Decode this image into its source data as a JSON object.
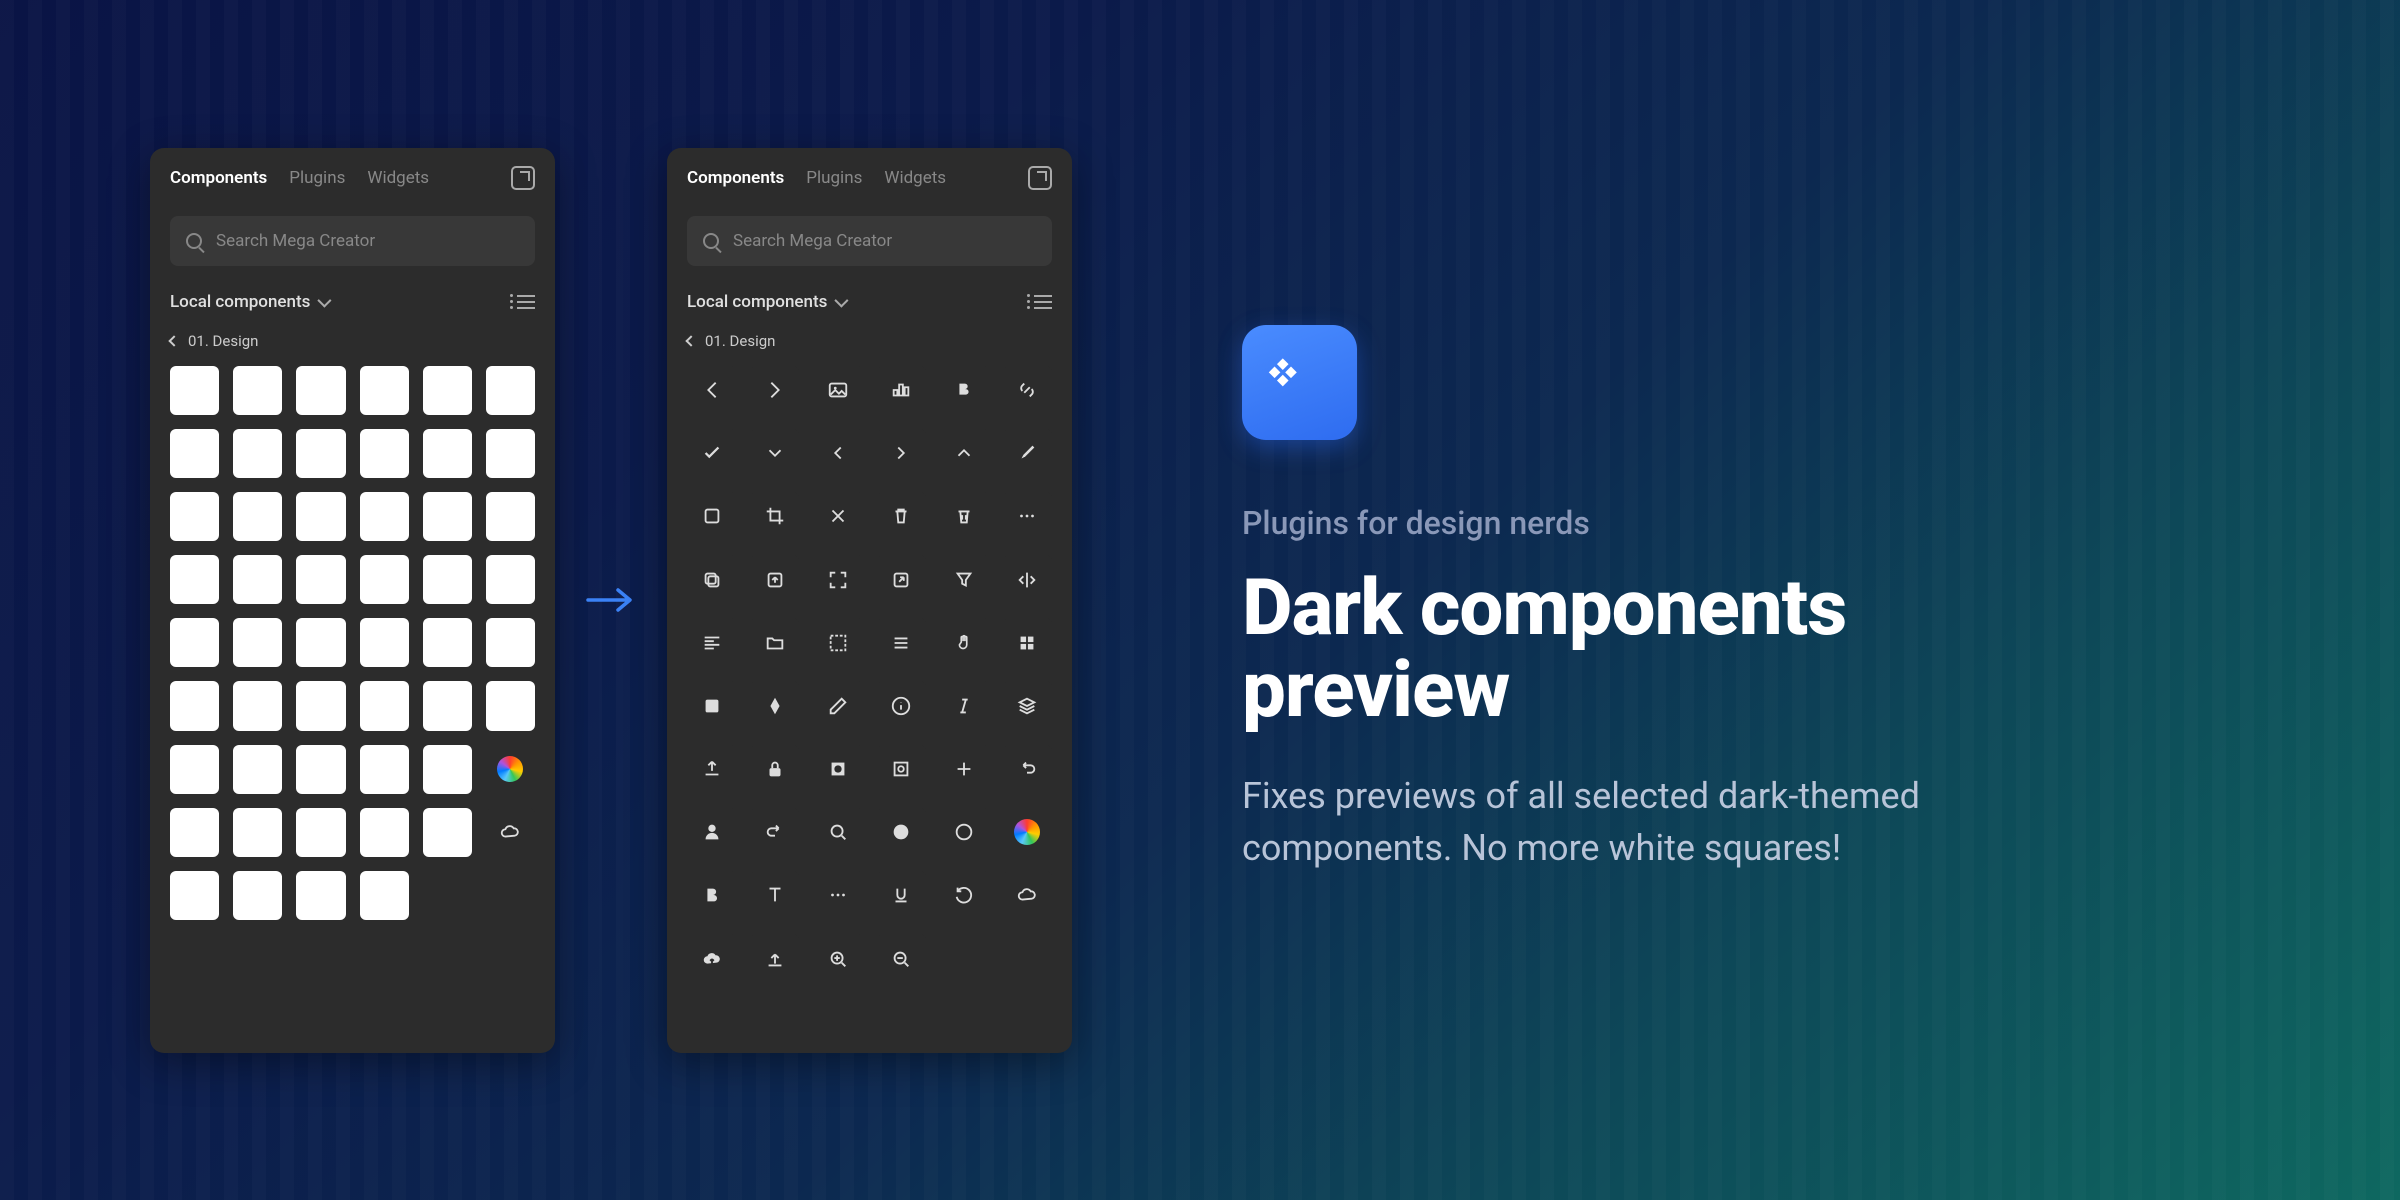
{
  "panel": {
    "tabs": [
      "Components",
      "Plugins",
      "Widgets"
    ],
    "active_tab": 0,
    "search_placeholder": "Search Mega Creator",
    "section_title": "Local components",
    "breadcrumb": "01. Design"
  },
  "left_panel": {
    "thumbnails": {
      "count": 52,
      "special": {
        "color_wheel_index": 41,
        "cloud_index": 47
      }
    }
  },
  "right_panel": {
    "icons": [
      "arrow-left",
      "arrow-right",
      "image",
      "chart",
      "bold",
      "link",
      "check",
      "chevron-down",
      "chevron-left",
      "chevron-right",
      "chevron-up",
      "paint",
      "square",
      "crop",
      "close",
      "trash",
      "trash-2",
      "more",
      "copy",
      "export",
      "fullscreen",
      "external",
      "filter",
      "flip",
      "align-left",
      "folder",
      "group",
      "menu",
      "hand",
      "grid",
      "shape",
      "pen",
      "pencil",
      "info",
      "italic",
      "layers",
      "upload",
      "lock",
      "mask",
      "target",
      "plus",
      "redo",
      "user",
      "undo",
      "search",
      "blob",
      "circle",
      "color-wheel",
      "text-bold",
      "text",
      "dots",
      "underline",
      "undo-2",
      "cloud",
      "cloud-up",
      "upload-2",
      "zoom-in",
      "zoom-out"
    ]
  },
  "hero": {
    "kicker": "Plugins for design nerds",
    "headline": "Dark components preview",
    "description": "Fixes previews of all selected dark-themed components. No more white squares!"
  }
}
